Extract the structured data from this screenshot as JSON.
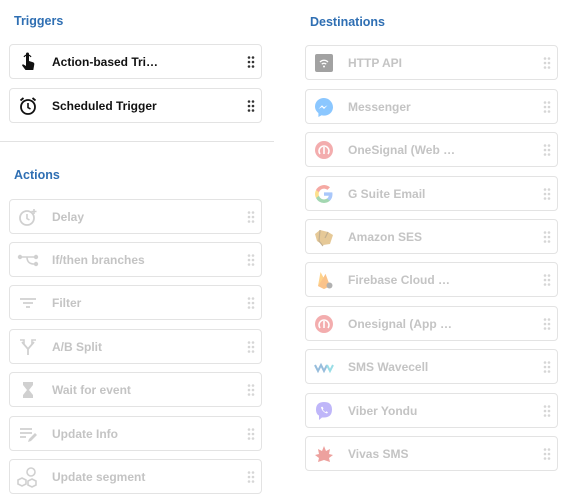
{
  "triggers": {
    "title": "Triggers",
    "items": [
      {
        "label": "Action-based Tri…",
        "icon": "tap-hand-icon"
      },
      {
        "label": "Scheduled Trigger",
        "icon": "alarm-clock-icon"
      }
    ]
  },
  "actions": {
    "title": "Actions",
    "items": [
      {
        "label": "Delay",
        "icon": "delay-clock-icon"
      },
      {
        "label": "If/then branches",
        "icon": "branch-icon"
      },
      {
        "label": "Filter",
        "icon": "filter-icon"
      },
      {
        "label": "A/B Split",
        "icon": "split-icon"
      },
      {
        "label": "Wait for event",
        "icon": "hourglass-icon"
      },
      {
        "label": "Update Info",
        "icon": "edit-list-icon"
      },
      {
        "label": "Update segment",
        "icon": "segment-icon"
      }
    ]
  },
  "destinations": {
    "title": "Destinations",
    "items": [
      {
        "label": "HTTP API",
        "icon": "http-api-icon"
      },
      {
        "label": "Messenger",
        "icon": "messenger-icon"
      },
      {
        "label": "OneSignal (Web …",
        "icon": "onesignal-icon"
      },
      {
        "label": "G Suite Email",
        "icon": "google-icon"
      },
      {
        "label": "Amazon SES",
        "icon": "amazon-ses-icon"
      },
      {
        "label": "Firebase Cloud …",
        "icon": "firebase-icon"
      },
      {
        "label": "Onesignal (App …",
        "icon": "onesignal-app-icon"
      },
      {
        "label": "SMS Wavecell",
        "icon": "wavecell-icon"
      },
      {
        "label": "Viber Yondu",
        "icon": "viber-icon"
      },
      {
        "label": "Vivas SMS",
        "icon": "vivas-icon"
      }
    ]
  },
  "colors": {
    "section_title": "#2f6fb3",
    "active_text": "#111111",
    "disabled_text": "#c4c4c4",
    "border": "#e3e3e3"
  }
}
